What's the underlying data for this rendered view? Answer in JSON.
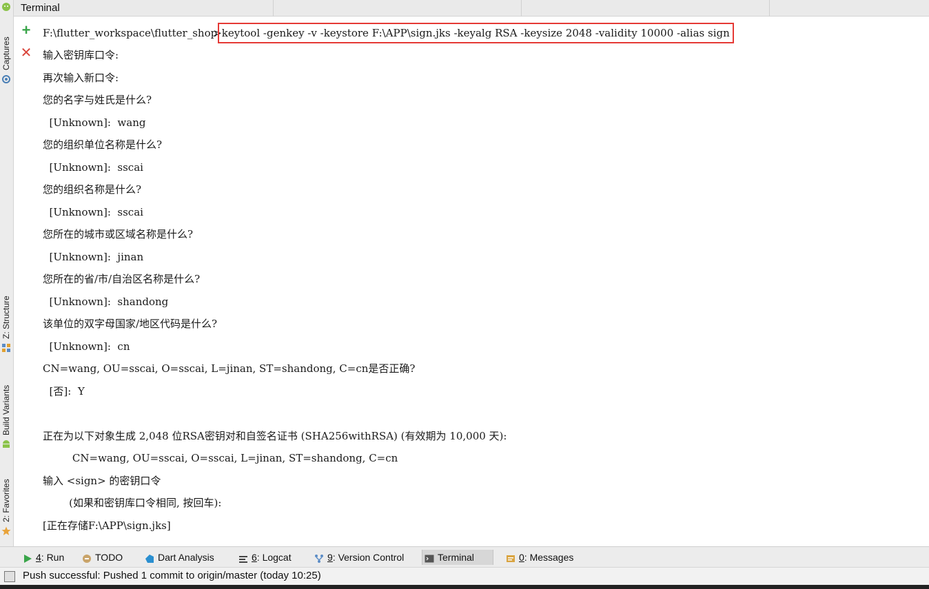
{
  "window": {
    "title": "Terminal"
  },
  "left_tools": [
    {
      "label": "Captures",
      "icon": "capture-icon"
    },
    {
      "label": "Z: Structure",
      "icon": "structure-icon"
    },
    {
      "label": "Build Variants",
      "icon": "android-icon"
    },
    {
      "label": "2: Favorites",
      "icon": "star-icon"
    }
  ],
  "terminal": {
    "prompt": "F:\\flutter_workspace\\flutter_shop",
    "command": "keytool -genkey -v -keystore F:\\APP\\sign.jks -keyalg RSA -keysize 2048 -validity 10000 -alias sign",
    "output": [
      "输入密钥库口令:",
      "再次输入新口令:",
      "您的名字与姓氏是什么?",
      "  [Unknown]:  wang",
      "您的组织单位名称是什么?",
      "  [Unknown]:  sscai",
      "您的组织名称是什么?",
      "  [Unknown]:  sscai",
      "您所在的城市或区域名称是什么?",
      "  [Unknown]:  jinan",
      "您所在的省/市/自治区名称是什么?",
      "  [Unknown]:  shandong",
      "该单位的双字母国家/地区代码是什么?",
      "  [Unknown]:  cn",
      "CN=wang, OU=sscai, O=sscai, L=jinan, ST=shandong, C=cn是否正确?",
      "  [否]:  Y",
      "",
      "正在为以下对象生成 2,048 位RSA密钥对和自签名证书 (SHA256withRSA) (有效期为 10,000 天):",
      "         CN=wang, OU=sscai, O=sscai, L=jinan, ST=shandong, C=cn",
      "输入 <sign> 的密钥口令",
      "        (如果和密钥库口令相同, 按回车):",
      "[正在存储F:\\APP\\sign.jks]"
    ]
  },
  "bottom_tabs": [
    {
      "num": "4",
      "label": ": Run",
      "icon": "run-icon"
    },
    {
      "num": "",
      "label": "TODO",
      "icon": "todo-icon"
    },
    {
      "num": "",
      "label": "Dart Analysis",
      "icon": "dart-icon"
    },
    {
      "num": "6",
      "label": ": Logcat",
      "icon": "logcat-icon"
    },
    {
      "num": "9",
      "label": ": Version Control",
      "icon": "vcs-icon"
    },
    {
      "num": "",
      "label": "Terminal",
      "icon": "terminal-icon",
      "active": true
    },
    {
      "num": "0",
      "label": ": Messages",
      "icon": "messages-icon"
    }
  ],
  "status": {
    "message": "Push successful: Pushed 1 commit to origin/master (today 10:25)"
  },
  "colors": {
    "highlight": "#e53935",
    "add": "#3aa54a",
    "close": "#d9453b"
  }
}
